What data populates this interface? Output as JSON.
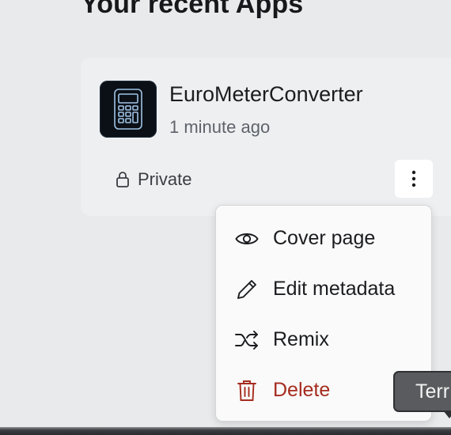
{
  "section": {
    "title": "Your recent Apps"
  },
  "app_card": {
    "name": "EuroMeterConverter",
    "updated": "1 minute ago",
    "visibility": "Private",
    "icon": "calculator-icon"
  },
  "context_menu": {
    "items": [
      {
        "label": "Cover page",
        "icon": "eye-icon"
      },
      {
        "label": "Edit metadata",
        "icon": "pencil-icon"
      },
      {
        "label": "Remix",
        "icon": "shuffle-icon"
      },
      {
        "label": "Delete",
        "icon": "trash-icon"
      }
    ]
  },
  "tooltip": {
    "text": "Terr"
  },
  "colors": {
    "background": "#e9eaec",
    "card": "#eeeff1",
    "menu": "#fafafa",
    "danger": "#a52b1e",
    "icon_bg": "#0b1016",
    "icon_accent": "#9fc4e6"
  }
}
